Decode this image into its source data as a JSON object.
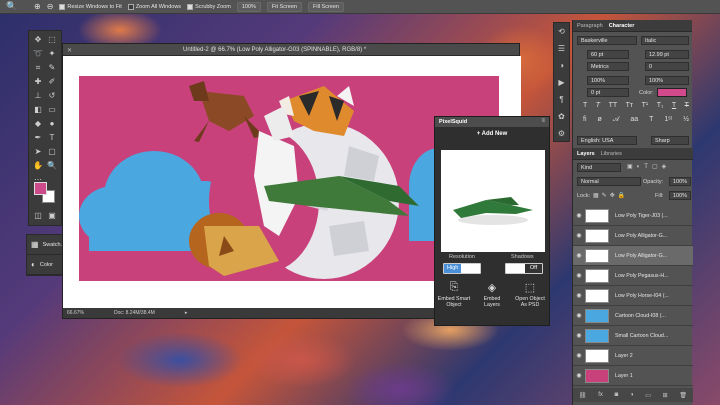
{
  "menubar": {
    "resize_label": "Resize Windows to Fit",
    "zoom_all_label": "Zoom All Windows",
    "scrubby_label": "Scrubby Zoom",
    "zoom_value": "100%",
    "fit_screen": "Fit Screen",
    "fill_screen": "Fill Screen"
  },
  "document": {
    "title": "Untitled-2 @ 66.7% (Low Poly Alligator-G03 (SPINNABLE), RGB/8) *",
    "zoom": "66.67%",
    "doc_size": "Doc: 8.24M/38.4M"
  },
  "mini_panels": [
    {
      "label": "Swatch..."
    },
    {
      "label": "Color"
    }
  ],
  "character_panel": {
    "tab_paragraph": "Paragraph",
    "tab_character": "Character",
    "font_family": "Baskerville",
    "font_style": "Italic",
    "size": "60 pt",
    "leading": "12.99 pt",
    "kerning": "Metrics",
    "tracking": "0",
    "vscale": "100%",
    "hscale": "100%",
    "baseline": "0 pt",
    "color_label": "Color:",
    "color_hex": "#d14b8c",
    "language": "English: USA",
    "aa": "Sharp"
  },
  "layers_panel": {
    "tab_layers": "Layers",
    "tab_libraries": "Libraries",
    "kind": "Kind",
    "blend": "Normal",
    "opacity_label": "Opacity:",
    "opacity": "100%",
    "lock_label": "Lock:",
    "fill_label": "Fill:",
    "fill": "100%",
    "layers": [
      {
        "name": "Low Poly Tiger-J03 (..."
      },
      {
        "name": "Low Poly Alligator-G..."
      },
      {
        "name": "Low Poly Alligator-G..."
      },
      {
        "name": "Low Poly Pegasus-H..."
      },
      {
        "name": "Low Poly Horse-I04 (..."
      },
      {
        "name": "Cartoon Cloud-I08 (..."
      },
      {
        "name": "Small Cartoon Cloud..."
      },
      {
        "name": "Layer 2"
      },
      {
        "name": "Layer 1"
      }
    ]
  },
  "pixelsquid": {
    "title": "PixelSquid",
    "add_new": "+ Add New",
    "resolution_label": "Resolution",
    "shadows_label": "Shadows",
    "high": "High",
    "off": "Off",
    "btn_embed_smart": "Embed Smart Object",
    "btn_embed_layers": "Embed Layers",
    "btn_open_psd": "Open Object As PSD"
  },
  "colors": {
    "artboard": "#c8417b",
    "cloud": "#4aa7e0",
    "foreground": "#cc4b8b"
  }
}
